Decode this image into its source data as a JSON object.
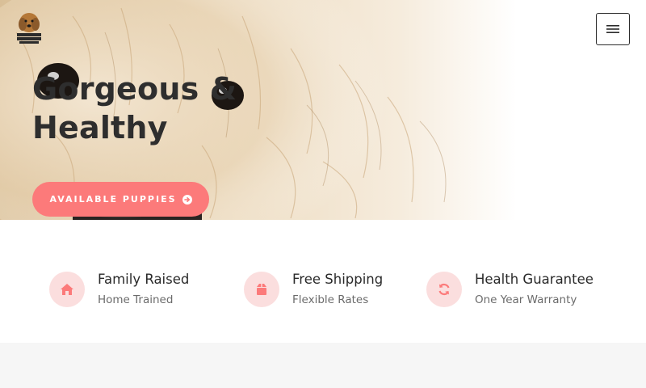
{
  "header": {
    "logo_icon": "dog-logo-icon",
    "menu_icon": "hamburger-menu-icon"
  },
  "hero": {
    "headline_line1": "Gorgeous &",
    "headline_line2": "Healthy",
    "cta_label": "AVAILABLE PUPPIES",
    "cta_icon": "arrow-circle-right-icon"
  },
  "features": [
    {
      "title": "Family Raised",
      "subtitle": "Home Trained",
      "icon": "home-icon"
    },
    {
      "title": "Free Shipping",
      "subtitle": "Flexible Rates",
      "icon": "box-icon"
    },
    {
      "title": "Health Guarantee",
      "subtitle": "One Year Warranty",
      "icon": "refresh-icon"
    }
  ],
  "colors": {
    "accent": "#fc7a7a",
    "icon_bg": "#fbdede",
    "headline": "#2e2e2e",
    "section_bg": "#f6f6f6"
  }
}
